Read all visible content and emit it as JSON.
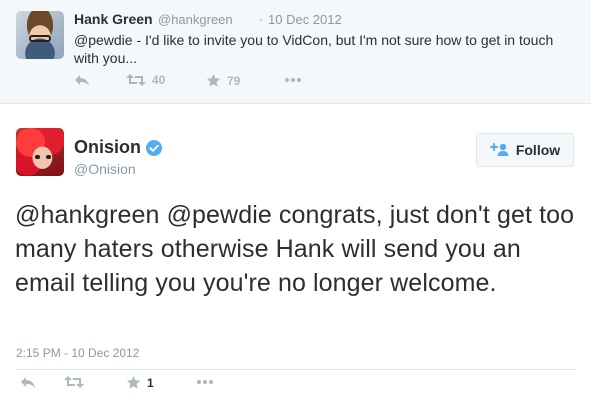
{
  "reply_tweet": {
    "name": "Hank Green",
    "handle": "@hankgreen",
    "separator": "·",
    "date": "10 Dec 2012",
    "text": "@pewdie - I'd like to invite you to VidCon, but I'm not sure how to get in touch with you...",
    "retweet_count": "40",
    "favorite_count": "79"
  },
  "main_tweet": {
    "name": "Onision",
    "handle": "@Onision",
    "follow_label": "Follow",
    "text": "@hankgreen @pewdie congrats, just don't get too many haters otherwise Hank will send you an email telling you you're no longer welcome.",
    "timestamp": "2:15 PM - 10 Dec 2012",
    "favorite_count": "1"
  },
  "colors": {
    "accent": "#55acee",
    "muted": "#8899a6",
    "icon": "#aab8c2",
    "text": "#292f33"
  },
  "icons": [
    "reply-icon",
    "retweet-icon",
    "favorite-icon",
    "more-icon",
    "verified-icon",
    "add-user-icon"
  ]
}
